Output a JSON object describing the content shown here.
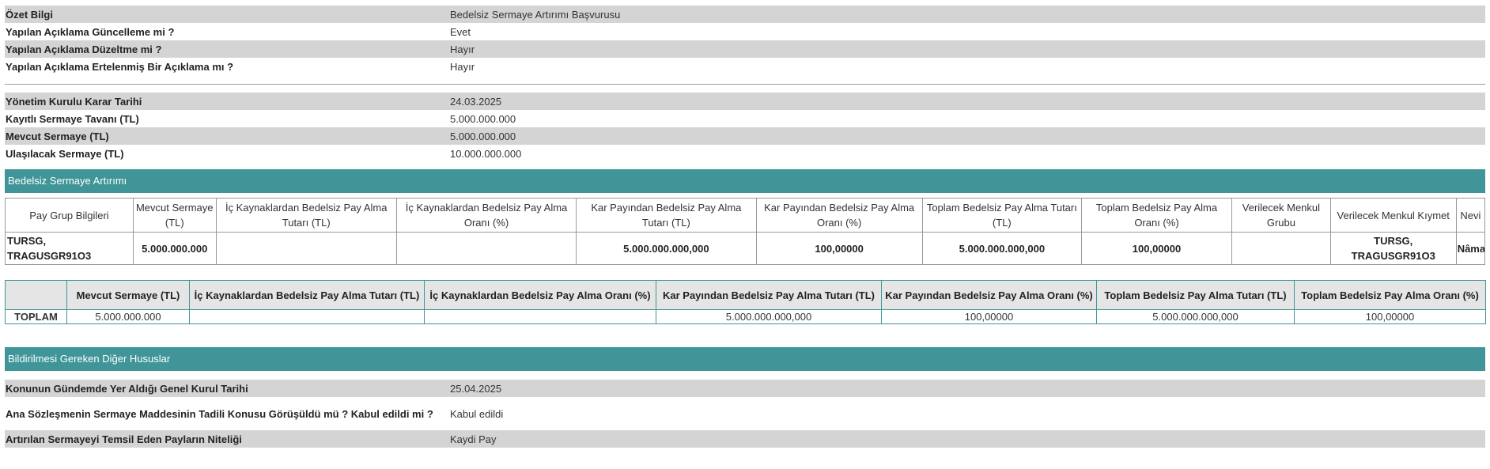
{
  "summary": [
    {
      "key": "Özet Bilgi",
      "value": "Bedelsiz Sermaye Artırımı Başvurusu"
    },
    {
      "key": "Yapılan Açıklama Güncelleme mi ?",
      "value": "Evet"
    },
    {
      "key": "Yapılan Açıklama Düzeltme mi ?",
      "value": "Hayır"
    },
    {
      "key": "Yapılan Açıklama Ertelenmiş Bir Açıklama mı ?",
      "value": "Hayır"
    }
  ],
  "capital": [
    {
      "key": "Yönetim Kurulu Karar Tarihi",
      "value": "24.03.2025"
    },
    {
      "key": "Kayıtlı Sermaye Tavanı (TL)",
      "value": "5.000.000.000"
    },
    {
      "key": "Mevcut Sermaye (TL)",
      "value": "5.000.000.000"
    },
    {
      "key": "Ulaşılacak Sermaye (TL)",
      "value": "10.000.000.000"
    }
  ],
  "section1": {
    "title": "Bedelsiz Sermaye Artırımı"
  },
  "detail_table": {
    "headers": [
      "Pay Grup Bilgileri",
      "Mevcut Sermaye (TL)",
      "İç Kaynaklardan Bedelsiz Pay Alma Tutarı (TL)",
      "İç Kaynaklardan Bedelsiz Pay Alma Oranı (%)",
      "Kar Payından Bedelsiz Pay Alma Tutarı (TL)",
      "Kar Payından Bedelsiz Pay Alma Oranı (%)",
      "Toplam Bedelsiz Pay Alma Tutarı (TL)",
      "Toplam Bedelsiz Pay Alma Oranı (%)",
      "Verilecek Menkul Grubu",
      "Verilecek Menkul Kıymet",
      "Nevi"
    ],
    "row": [
      "TURSG, TRAGUSGR91O3",
      "5.000.000.000",
      "",
      "",
      "5.000.000.000,000",
      "100,00000",
      "5.000.000.000,000",
      "100,00000",
      "",
      "TURSG, TRAGUSGR91O3",
      "Nâma"
    ]
  },
  "total_table": {
    "headers": [
      "",
      "Mevcut Sermaye (TL)",
      "İç Kaynaklardan Bedelsiz Pay Alma Tutarı (TL)",
      "İç Kaynaklardan Bedelsiz Pay Alma Oranı (%)",
      "Kar Payından Bedelsiz Pay Alma Tutarı (TL)",
      "Kar Payından Bedelsiz Pay Alma Oranı (%)",
      "Toplam Bedelsiz Pay Alma Tutarı (TL)",
      "Toplam Bedelsiz Pay Alma Oranı (%)"
    ],
    "row": [
      "TOPLAM",
      "5.000.000.000",
      "",
      "",
      "5.000.000.000,000",
      "100,00000",
      "5.000.000.000,000",
      "100,00000"
    ]
  },
  "section2": {
    "title": "Bildirilmesi Gereken Diğer Hususlar"
  },
  "other": [
    {
      "key": "Konunun Gündemde Yer Aldığı Genel Kurul Tarihi",
      "value": "25.04.2025"
    },
    {
      "key": "Ana Sözleşmenin Sermaye Maddesinin Tadili Konusu Görüşüldü mü ? Kabul edildi mi ?",
      "value": "Kabul edildi"
    },
    {
      "key": "Artırılan Sermayeyi Temsil Eden Payların Niteliği",
      "value": "Kaydi Pay"
    }
  ],
  "colors": {
    "section_header": "#3f9598",
    "row_shade": "#d4d4d4",
    "table_header": "#e5e5e5"
  }
}
